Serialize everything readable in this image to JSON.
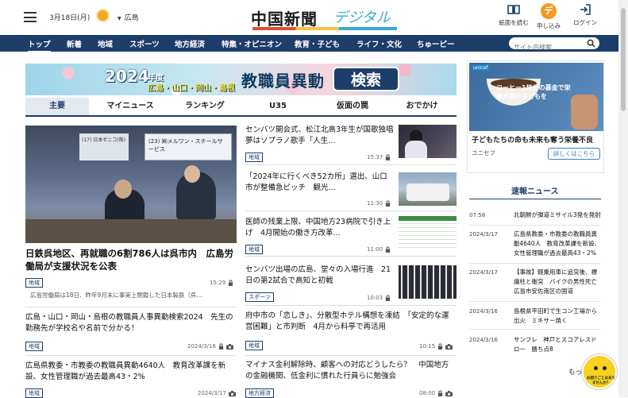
{
  "header": {
    "date": "3月18日(月)",
    "location": "広島",
    "logo_main": "中国新聞",
    "logo_sub": "デジタル",
    "buttons": [
      {
        "label": "紙面を読む",
        "icon": "newspaper-icon"
      },
      {
        "label": "申し込み",
        "icon": "subscribe-icon",
        "glyph": "デ"
      },
      {
        "label": "ログイン",
        "icon": "login-icon"
      }
    ]
  },
  "nav": {
    "items": [
      "トップ",
      "新着",
      "地域",
      "スポーツ",
      "地方経済",
      "特集・オピニオン",
      "教育・子ども",
      "ライフ・文化",
      "ちゅーピー"
    ],
    "active": "トップ",
    "search_placeholder": "サイト内検索"
  },
  "banner": {
    "year": "2024",
    "nendo": "年度",
    "areas": "広島・山口・岡山・島根",
    "title": "教職員異動",
    "button": "検索"
  },
  "tabs": [
    "主要",
    "マイニュース",
    "ランキング",
    "U35",
    "仮面の罠",
    "おでかけ"
  ],
  "hero": {
    "board_text": "(23) ㈱メルワン・スチールサービス",
    "board_text2": "(17) 日本ゼニコ(株)",
    "title": "日鉄呉地区、再就職の6割786人は呉市内　広島労働局が支援状況を公表",
    "tag": "地域",
    "time": "15:29",
    "lead": "広島労働局は18日、昨年9月末に事実上閉鎖した日本製鉄（呉..."
  },
  "stories_left": [
    {
      "title": "広島・山口・岡山・島根の教職員人事異動検索2024　先生の勤務先が学校名や名前で分かる！",
      "tag": "地域",
      "time": "2024/3/16"
    },
    {
      "title": "広島県教委・市教委の教職員異動4640人　教育改革課を新設、女性管理職が過去最高43・2%",
      "tag": "地域",
      "time": "2024/3/17"
    }
  ],
  "stories_mid": [
    {
      "title": "センバツ開会式、松江北高3年生が国歌独唱　夢はソプラノ歌手「人生...",
      "tag": "地域",
      "time": "15:37"
    },
    {
      "title": "「2024年に行くべき52カ所」選出、山口市が整備急ピッチ　観光...",
      "tag": "地域",
      "time": "11:30"
    },
    {
      "title": "医師の残業上限、中国地方23病院で引き上げ　4月開始の働き方改革...",
      "tag": "地域",
      "time": "11:00"
    },
    {
      "title": "センバツ出場の広島、堂々の入場行進　21日の第2試合で高知と初戦",
      "tag": "スポーツ",
      "time": "10:03"
    },
    {
      "title": "府中市の「恋しき」、分散型ホテル構想を凍結　「安定的な運営困難」と市判断　4月から料亭で再活用",
      "tag": "地域",
      "time": "10:15"
    },
    {
      "title": "マイナス金利解除時、顧客への対応どうしたら？　中国地方の金融機関、低金利に慣れた行員らに勉強会",
      "tag": "地方経済",
      "time": "08:00"
    }
  ],
  "ad": {
    "badge": "unicef",
    "overlay": "コーヒー1杯分の募金で栄養不良の子どもを",
    "title": "子どもたちの命も未来も奪う栄養不良",
    "source": "ユニセフ",
    "button": "詳しくはこちら"
  },
  "flash": {
    "heading": "速報ニュース",
    "items": [
      {
        "time": "07:58",
        "text": "北朝鮮が弾道ミサイル3発を発射"
      },
      {
        "time": "2024/3/17",
        "text": "広島県教委・市教委の教職員異動4640人　教育改革課を新設、女性管理職が過去最高43・2%"
      },
      {
        "time": "2024/3/17",
        "text": "【事故】軽乗用車に追突後、標識柱と衝突　バイクの男性死亡　広島市安佐南区の国道"
      },
      {
        "time": "2024/3/16",
        "text": "島根県平田町で生コン工場から出火　ミキサー焼く"
      },
      {
        "time": "2024/3/16",
        "text": "サンフレ　神戸とスコアレスドロー　勝ち点8"
      }
    ],
    "more": "もっ"
  },
  "mascot": {
    "text": "お困りごとはありませんか？"
  }
}
